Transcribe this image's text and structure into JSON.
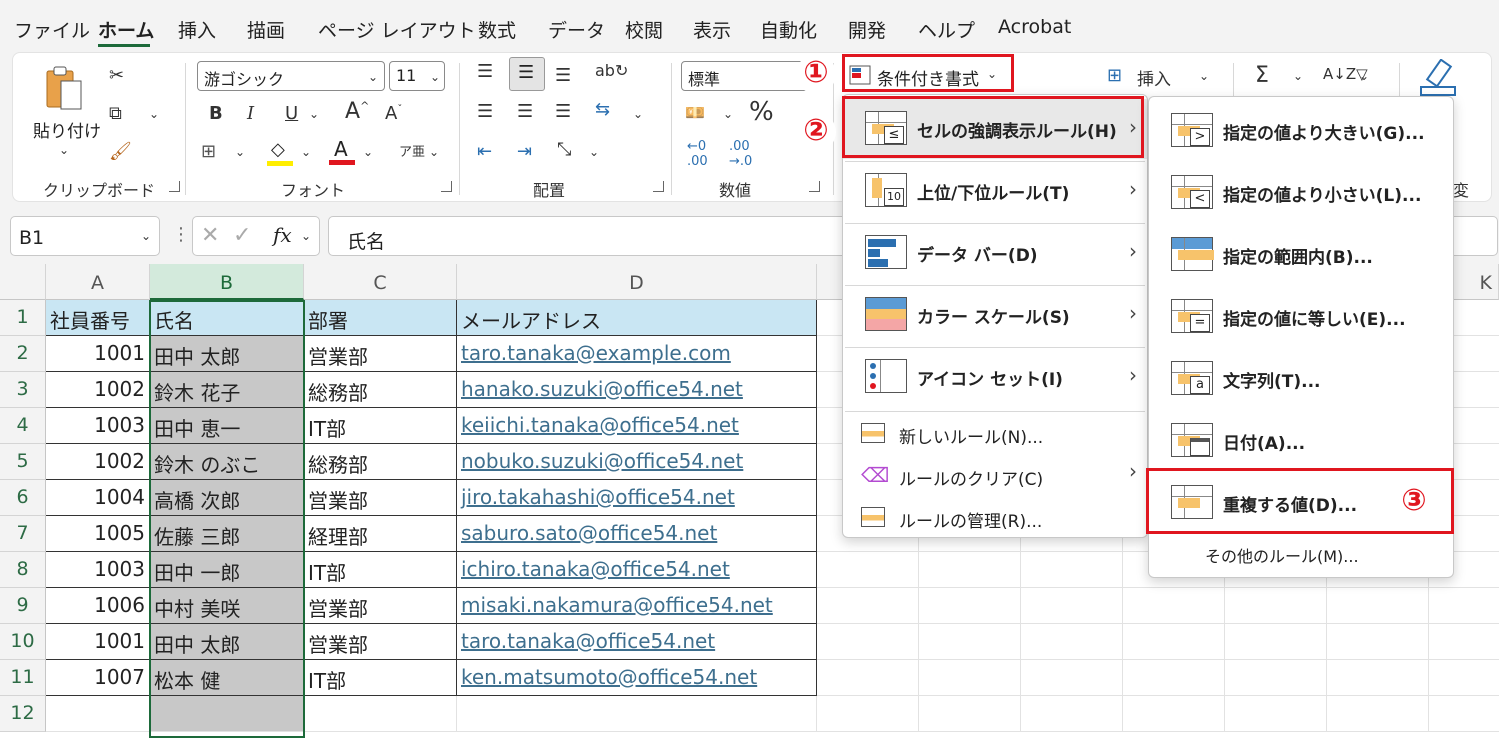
{
  "menubar": {
    "tabs": [
      {
        "label": "ファイル",
        "active": false
      },
      {
        "label": "ホーム",
        "active": true
      },
      {
        "label": "挿入",
        "active": false
      },
      {
        "label": "描画",
        "active": false
      },
      {
        "label": "ページ レイアウト",
        "active": false
      },
      {
        "label": "数式",
        "active": false
      },
      {
        "label": "データ",
        "active": false
      },
      {
        "label": "校閲",
        "active": false
      },
      {
        "label": "表示",
        "active": false
      },
      {
        "label": "自動化",
        "active": false
      },
      {
        "label": "開発",
        "active": false
      },
      {
        "label": "ヘルプ",
        "active": false
      },
      {
        "label": "Acrobat",
        "active": false
      }
    ]
  },
  "ribbon": {
    "clipboard": {
      "paste_label": "貼り付け",
      "group_label": "クリップボード"
    },
    "font": {
      "font_name": "游ゴシック",
      "font_size": "11",
      "group_label": "フォント"
    },
    "alignment": {
      "group_label": "配置"
    },
    "number": {
      "format": "標準",
      "percent": "%",
      "group_label": "数値"
    },
    "styles": {
      "conditional_formatting": "条件付き書式"
    },
    "cells": {
      "insert": "挿入"
    },
    "partial_label": "変"
  },
  "formula_bar": {
    "name_box": "B1",
    "formula": "氏名",
    "fx": "fx"
  },
  "grid": {
    "columns": [
      "A",
      "B",
      "C",
      "D"
    ],
    "extra_column": "K",
    "header_row": [
      "社員番号",
      "氏名",
      "部署",
      "メールアドレス"
    ],
    "rows": [
      {
        "num": "1001",
        "name": "田中 太郎",
        "dept": "営業部",
        "email": "taro.tanaka@example.com"
      },
      {
        "num": "1002",
        "name": "鈴木 花子",
        "dept": "総務部",
        "email": "hanako.suzuki@office54.net"
      },
      {
        "num": "1003",
        "name": "田中 恵一",
        "dept": "IT部",
        "email": "keiichi.tanaka@office54.net"
      },
      {
        "num": "1002",
        "name": "鈴木 のぶこ",
        "dept": "総務部",
        "email": "nobuko.suzuki@office54.net"
      },
      {
        "num": "1004",
        "name": "高橋 次郎",
        "dept": "営業部",
        "email": "jiro.takahashi@office54.net"
      },
      {
        "num": "1005",
        "name": "佐藤 三郎",
        "dept": "経理部",
        "email": "saburo.sato@office54.net"
      },
      {
        "num": "1003",
        "name": "田中 一郎",
        "dept": "IT部",
        "email": "ichiro.tanaka@office54.net"
      },
      {
        "num": "1006",
        "name": "中村 美咲",
        "dept": "営業部",
        "email": "misaki.nakamura@office54.net"
      },
      {
        "num": "1001",
        "name": "田中 太郎",
        "dept": "営業部",
        "email": "taro.tanaka@office54.net"
      },
      {
        "num": "1007",
        "name": "松本 健",
        "dept": "IT部",
        "email": "ken.matsumoto@office54.net"
      }
    ],
    "row_numbers": [
      "1",
      "2",
      "3",
      "4",
      "5",
      "6",
      "7",
      "8",
      "9",
      "10",
      "11",
      "12"
    ]
  },
  "cf_menu": {
    "items": [
      {
        "label": "セルの強調表示ルール(H)",
        "icon": "highlight-cells-icon",
        "submenu": true
      },
      {
        "label": "上位/下位ルール(T)",
        "icon": "top-bottom-icon",
        "submenu": true
      },
      {
        "label": "データ バー(D)",
        "icon": "data-bar-icon",
        "submenu": true
      },
      {
        "label": "カラー スケール(S)",
        "icon": "color-scale-icon",
        "submenu": true
      },
      {
        "label": "アイコン セット(I)",
        "icon": "icon-set-icon",
        "submenu": true
      }
    ],
    "bottom_items": [
      {
        "label": "新しいルール(N)...",
        "icon": "new-rule-icon"
      },
      {
        "label": "ルールのクリア(C)",
        "icon": "clear-rules-icon"
      },
      {
        "label": "ルールの管理(R)...",
        "icon": "manage-rules-icon"
      }
    ],
    "top_bottom_icon_text": "10"
  },
  "submenu": {
    "items": [
      {
        "label": "指定の値より大きい(G)...",
        "sym": ">"
      },
      {
        "label": "指定の値より小さい(L)...",
        "sym": "<"
      },
      {
        "label": "指定の範囲内(B)...",
        "sym": ""
      },
      {
        "label": "指定の値に等しい(E)...",
        "sym": "="
      },
      {
        "label": "文字列(T)...",
        "sym": "a"
      },
      {
        "label": "日付(A)...",
        "sym": ""
      },
      {
        "label": "重複する値(D)...",
        "sym": ""
      }
    ],
    "more_rules": "その他のルール(M)..."
  },
  "annotations": {
    "step1": "①",
    "step2": "②",
    "step3": "③",
    "color": "#e0161f"
  }
}
